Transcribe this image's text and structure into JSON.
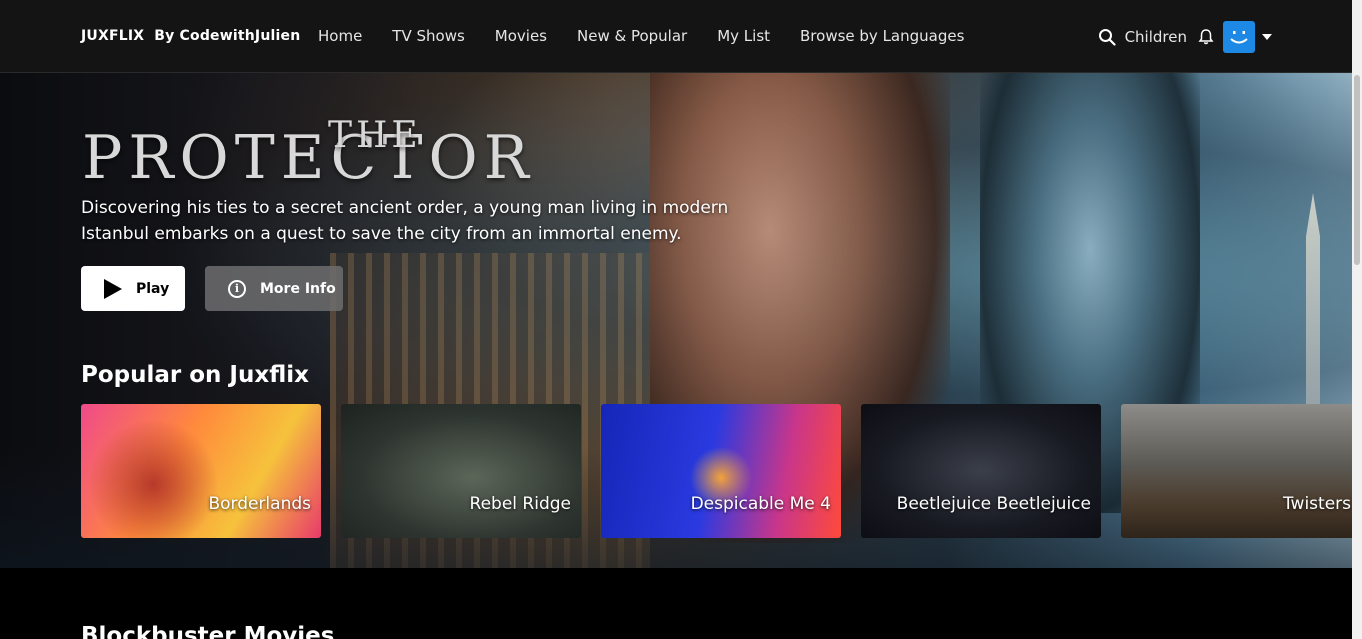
{
  "navbar": {
    "brand": "JUXFLIX",
    "brand_by": "By CodewithJulien",
    "links": [
      "Home",
      "TV Shows",
      "Movies",
      "New & Popular",
      "My List",
      "Browse by Languages"
    ],
    "profile_label": "Children",
    "icons": {
      "search": "search-icon",
      "notifications": "bell-icon",
      "avatar": "smiley-avatar",
      "dropdown": "caret-down-icon"
    }
  },
  "hero": {
    "title_small": "THE",
    "title": "PROTECTOR",
    "description": "Discovering his ties to a secret ancient order, a young man living in modern Istanbul embarks on a quest to save the city from an immortal enemy.",
    "play_label": "Play",
    "info_label": "More Info"
  },
  "rows": [
    {
      "title": "Popular on Juxflix",
      "items": [
        "Borderlands",
        "Rebel Ridge",
        "Despicable Me 4",
        "Beetlejuice Beetlejuice",
        "Twisters"
      ]
    },
    {
      "title": "Blockbuster Movies"
    }
  ],
  "colors": {
    "nav_bg": "#141414",
    "avatar": "#1e88e5",
    "page_bg": "#000000"
  }
}
